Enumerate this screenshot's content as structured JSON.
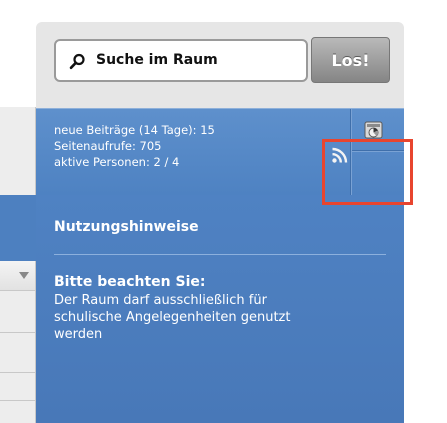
{
  "search": {
    "placeholder": "Suche im Raum",
    "button_label": "Los!"
  },
  "stats": {
    "new_posts": "neue Beiträge (14 Tage): 15",
    "page_views": "Seitenaufrufe: 705",
    "active_people": "aktive Personen: 2 / 4"
  },
  "icons": {
    "stats": "statistics-icon",
    "feed": "rss-icon",
    "search": "search-icon"
  },
  "usage_notes": {
    "title": "Nutzungshinweise",
    "heading": "Bitte beachten Sie:",
    "body_lines": [
      "Der Raum darf ausschließlich für",
      "schulische Angelegenheiten genutzt",
      "werden"
    ]
  },
  "colors": {
    "panel_blue": "#4e82c2",
    "highlight": "#e8452f",
    "button_gray": "#9a9a9a"
  }
}
